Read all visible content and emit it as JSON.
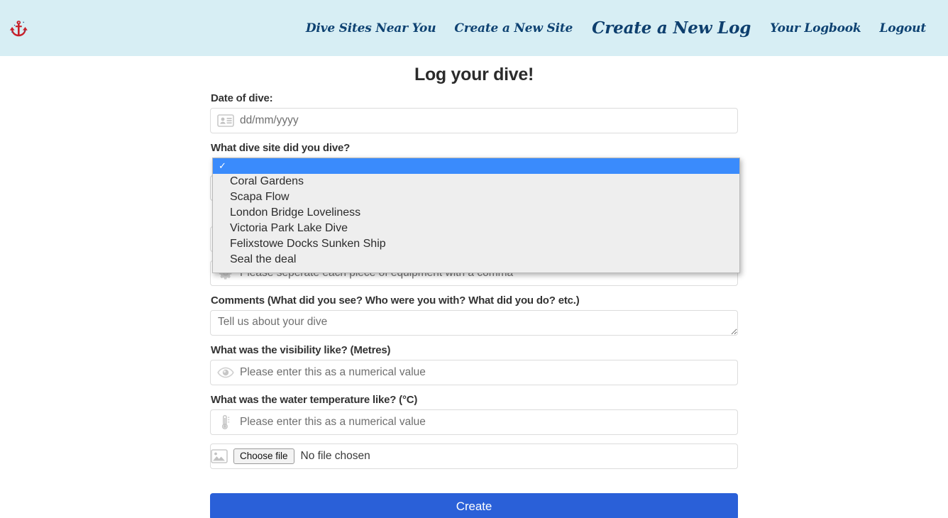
{
  "nav": {
    "brand_icon": "anchor-logo-icon",
    "links": [
      {
        "label": "Dive Sites Near You",
        "active": false
      },
      {
        "label": "Create a New Site",
        "active": false
      },
      {
        "label": "Create a New Log",
        "active": true
      },
      {
        "label": "Your Logbook",
        "active": false
      },
      {
        "label": "Logout",
        "active": false
      }
    ]
  },
  "page": {
    "title": "Log your dive!"
  },
  "form": {
    "date": {
      "label": "Date of dive:",
      "placeholder": "dd/mm/yyyy",
      "value": "",
      "icon": "contact-card-icon"
    },
    "dive_site": {
      "label": "What dive site did you dive?",
      "selected_value": "",
      "options": [
        "",
        "Coral Gardens",
        "Scapa Flow",
        "London Bridge Loveliness",
        "Victoria Park Lake Dive",
        "Felixstowe Docks Sunken Ship",
        "Seal the deal"
      ]
    },
    "equipment": {
      "placeholder": "Please seperate each piece of equipment with a comma",
      "value": "",
      "icon": "gear-icon"
    },
    "comments": {
      "label": "Comments (What did you see? Who were you with? What did you do? etc.)",
      "placeholder": "Tell us about your dive",
      "value": ""
    },
    "visibility": {
      "label": "What was the visibility like? (Metres)",
      "placeholder": "Please enter this as a numerical value",
      "value": "",
      "icon": "eye-icon"
    },
    "temperature": {
      "label": "What was the water temperature like? (°C)",
      "placeholder": "Please enter this as a numerical value",
      "value": "",
      "icon": "thermometer-icon"
    },
    "photo": {
      "button_label": "Choose file",
      "status": "No file chosen",
      "icon": "image-icon"
    },
    "submit": {
      "label": "Create"
    }
  },
  "colors": {
    "header_bg": "#d7eef4",
    "nav_text": "#0e4272",
    "accent_button": "#2a60d8",
    "dropdown_selected": "#3a8bfc",
    "dropdown_bg": "#eeeeee",
    "logo_red": "#c8202a"
  }
}
